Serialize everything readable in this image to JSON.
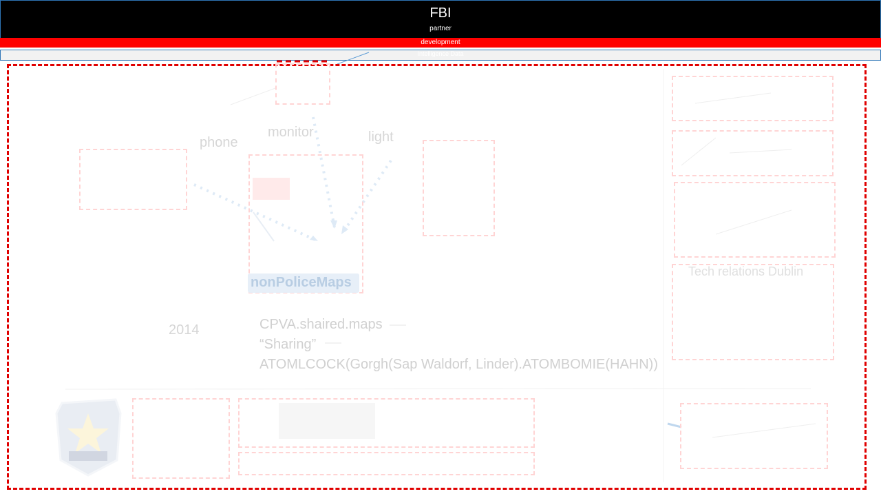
{
  "header": {
    "title": "FBI",
    "subtitle": "partner"
  },
  "bars": {
    "development": "development",
    "grey_label": "Intelligence Data"
  },
  "diagram": {
    "labels": {
      "phone": "phone",
      "monitor": "monitor",
      "light": "light",
      "year": "2014"
    },
    "badge": "nonPoliceMaps",
    "text_lines": [
      "CPVA.shaired.maps",
      "“Sharing”",
      "ATOMLCOCK(Gorgh(Sap Waldorf, Linder).ATOMBOMIE(HAHN))"
    ],
    "right_caption": "Tech relations Dublin"
  },
  "colors": {
    "header_bg": "#000000",
    "accent_red": "#ff0000",
    "frame_border": "#e00000",
    "link_blue": "#2e75b6"
  }
}
